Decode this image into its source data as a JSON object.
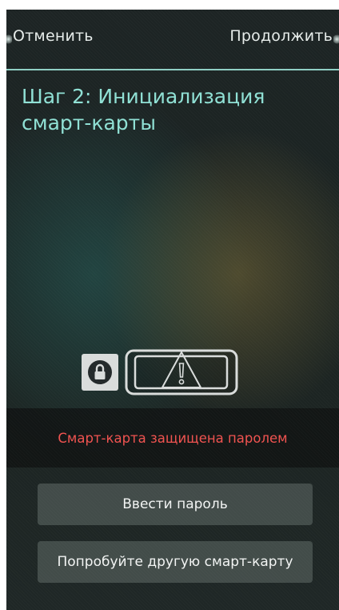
{
  "header": {
    "cancel_label": "Отменить",
    "continue_label": "Продолжить"
  },
  "step": {
    "title": "Шаг 2: Инициализация смарт-карты"
  },
  "status": {
    "message": "Смарт-карта защищена паролем",
    "color": "#f0524f"
  },
  "actions": {
    "enter_password_label": "Ввести пароль",
    "try_other_card_label": "Попробуйте другую смарт-карту"
  },
  "icons": {
    "lock": "lock-icon",
    "warning": "warning-icon",
    "smart_card": "smart-card-icon"
  },
  "colors": {
    "accent": "#8fe0d4",
    "divider": "#8fcfc4",
    "error": "#f0524f"
  }
}
